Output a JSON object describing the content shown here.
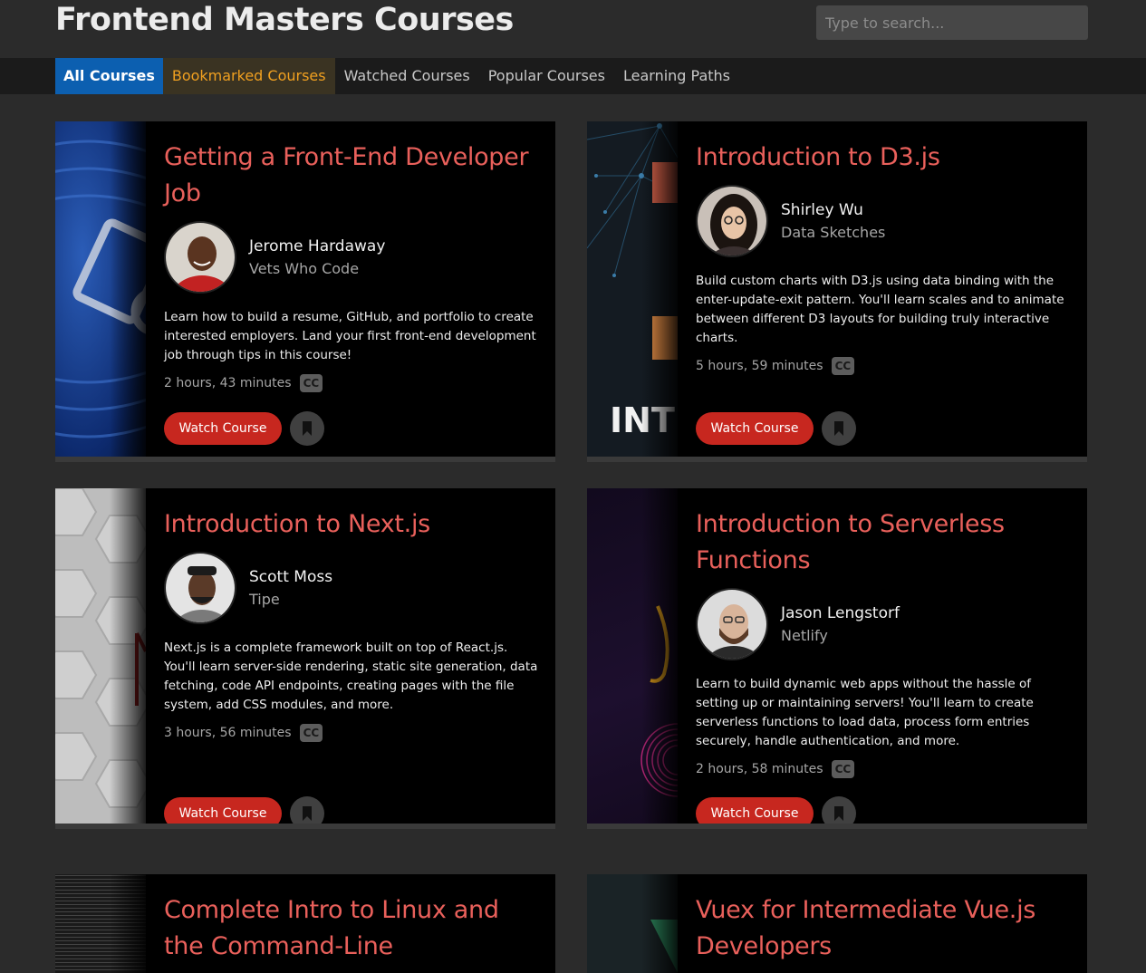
{
  "header": {
    "title": "Frontend Masters Courses",
    "search_placeholder": "Type to search..."
  },
  "nav": {
    "tabs": [
      {
        "label": "All Courses"
      },
      {
        "label": "Bookmarked Courses"
      },
      {
        "label": "Watched Courses"
      },
      {
        "label": "Popular Courses"
      },
      {
        "label": "Learning Paths"
      }
    ]
  },
  "courses": [
    {
      "title": "Getting a Front-End Developer Job",
      "instructor": "Jerome Hardaway",
      "org": "Vets Who Code",
      "description": "Learn how to build a resume, GitHub, and portfolio to create interested employers. Land your first front-end development job through tips in this course!",
      "duration": "2 hours, 43 minutes",
      "cc": "CC",
      "watch_label": "Watch Course"
    },
    {
      "title": "Introduction to D3.js",
      "instructor": "Shirley Wu",
      "org": "Data Sketches",
      "description": "Build custom charts with D3.js using data binding with the enter-update-exit pattern. You'll learn scales and to animate between different D3 layouts for building truly interactive charts.",
      "duration": "5 hours, 59 minutes",
      "cc": "CC",
      "watch_label": "Watch Course",
      "thumb_text": "INT"
    },
    {
      "title": "Introduction to Next.js",
      "instructor": "Scott Moss",
      "org": "Tipe",
      "description": "Next.js is a complete framework built on top of React.js. You'll learn server-side rendering, static site generation, data fetching, code API endpoints, creating pages with the file system, add CSS modules, and more.",
      "duration": "3 hours, 56 minutes",
      "cc": "CC",
      "watch_label": "Watch Course"
    },
    {
      "title": "Introduction to Serverless Functions",
      "instructor": "Jason Lengstorf",
      "org": "Netlify",
      "description": "Learn to build dynamic web apps without the hassle of setting up or maintaining servers! You'll learn to create serverless functions to load data, process form entries securely, handle authentication, and more.",
      "duration": "2 hours, 58 minutes",
      "cc": "CC",
      "watch_label": "Watch Course"
    },
    {
      "title": "Complete Intro to Linux and the Command-Line"
    },
    {
      "title": "Vuex for Intermediate Vue.js Developers"
    }
  ]
}
